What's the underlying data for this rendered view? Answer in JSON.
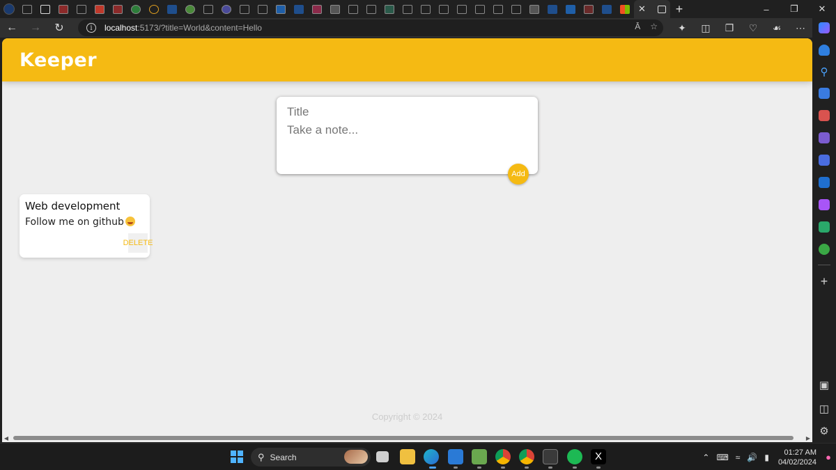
{
  "browser": {
    "url_host": "localhost",
    "url_rest": ":5173/?title=World&content=Hello",
    "read_aloud_label": "Ā",
    "close_tab_label": "✕",
    "new_tab_label": "+"
  },
  "app": {
    "title": "Keeper",
    "colors": {
      "accent": "#f5ba13",
      "background": "#eeeeee",
      "card": "#ffffff"
    }
  },
  "create_note": {
    "title_placeholder": "Title",
    "content_placeholder": "Take a note...",
    "add_label": "Add"
  },
  "notes": [
    {
      "title": "Web development",
      "content": "Follow me on github",
      "delete_label": "DELETE"
    }
  ],
  "footer": {
    "text": "Copyright © 2024"
  },
  "taskbar": {
    "search_label": "Search",
    "time": "01:27 AM",
    "date": "04/02/2024"
  }
}
